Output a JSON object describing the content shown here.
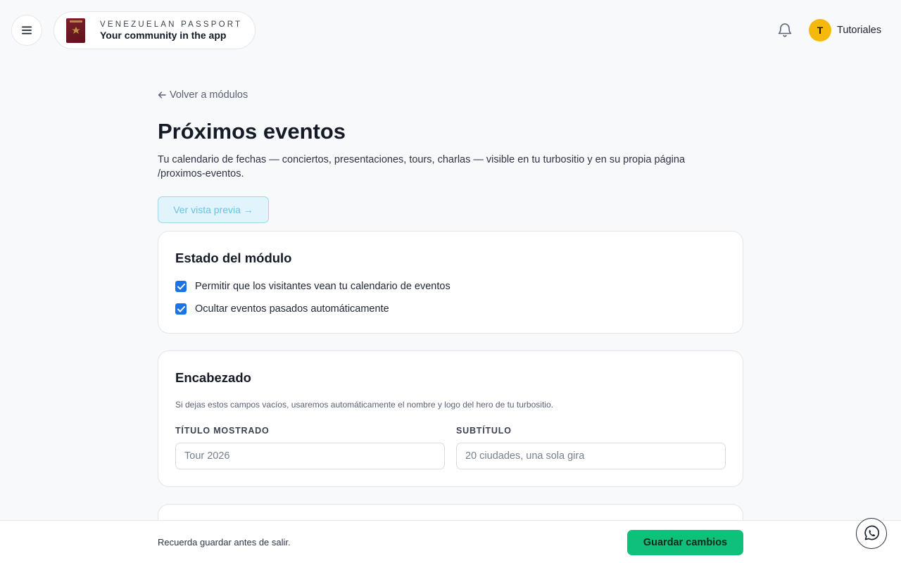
{
  "header": {
    "brand_kicker": "VENEZUELAN PASSPORT",
    "brand_title": "Your community in the app",
    "user_initial": "T",
    "user_name": "Tutoriales"
  },
  "main": {
    "back_link": "Volver a módulos",
    "title": "Próximos eventos",
    "description": "Tu calendario de fechas — conciertos, presentaciones, tours, charlas — visible en tu turbositio y en su propia página /proximos-eventos.",
    "preview_button": "Ver vista previa →"
  },
  "module_state": {
    "title": "Estado del módulo",
    "options": [
      {
        "label": "Permitir que los visitantes vean tu calendario de eventos",
        "checked": true
      },
      {
        "label": "Ocultar eventos pasados automáticamente",
        "checked": true
      }
    ]
  },
  "heading_section": {
    "title": "Encabezado",
    "hint": "Si dejas estos campos vacíos, usaremos automáticamente el nombre y logo del hero de tu turbositio.",
    "title_field": {
      "label": "TÍTULO MOSTRADO",
      "value": "",
      "placeholder": "Tour 2026"
    },
    "subtitle_field": {
      "label": "SUBTÍTULO",
      "value": "",
      "placeholder": "20 ciudades, una sola gira"
    }
  },
  "footer": {
    "note": "Recuerda guardar antes de salir.",
    "save_button": "Guardar cambios"
  },
  "colors": {
    "accent_blue": "#1a73e8",
    "save_green": "#0ec07a",
    "avatar_yellow": "#f5b90d",
    "passport_red": "#7d1f2a"
  },
  "icons": [
    "menu-icon",
    "bell-icon",
    "arrow-left-icon",
    "check-icon",
    "whatsapp-icon"
  ]
}
